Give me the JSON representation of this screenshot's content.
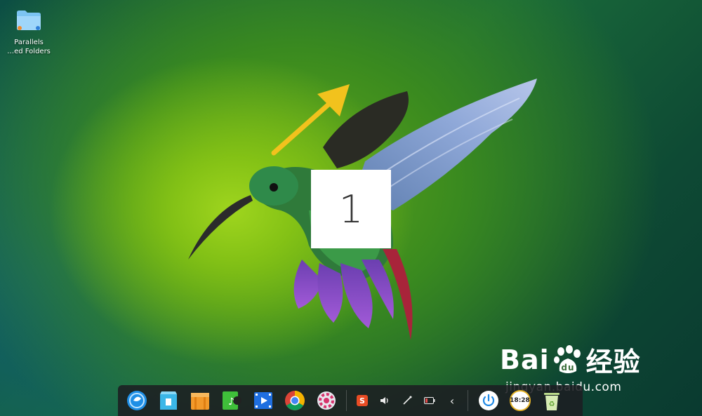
{
  "desktop": {
    "icons": [
      {
        "label_line1": "Parallels",
        "label_line2": "…ed Folders"
      }
    ]
  },
  "overlay": {
    "step_number": "1"
  },
  "watermark": {
    "brand": "Bai",
    "brand_suffix": "经验",
    "url": "jingyan.baidu.com"
  },
  "dock": {
    "apps": [
      {
        "name": "deepin launcher",
        "icon": "deepin-logo-icon"
      },
      {
        "name": "app store",
        "icon": "app-store-icon"
      },
      {
        "name": "file manager",
        "icon": "file-manager-icon"
      },
      {
        "name": "music",
        "icon": "music-icon"
      },
      {
        "name": "video",
        "icon": "video-icon"
      },
      {
        "name": "chrome",
        "icon": "chrome-icon"
      },
      {
        "name": "settings",
        "icon": "settings-icon"
      }
    ],
    "tray": [
      {
        "icon": "sogou-input-icon",
        "glyph": "S"
      },
      {
        "icon": "volume-icon",
        "glyph": "🔈"
      },
      {
        "icon": "network-icon",
        "glyph": "⤢"
      },
      {
        "icon": "battery-icon",
        "glyph": ""
      },
      {
        "icon": "chevron-left-icon",
        "glyph": "‹"
      }
    ],
    "clock_text": "18:28",
    "colors": {
      "accent": "#1e88e5",
      "dock_bg": "#1c1e22"
    }
  }
}
